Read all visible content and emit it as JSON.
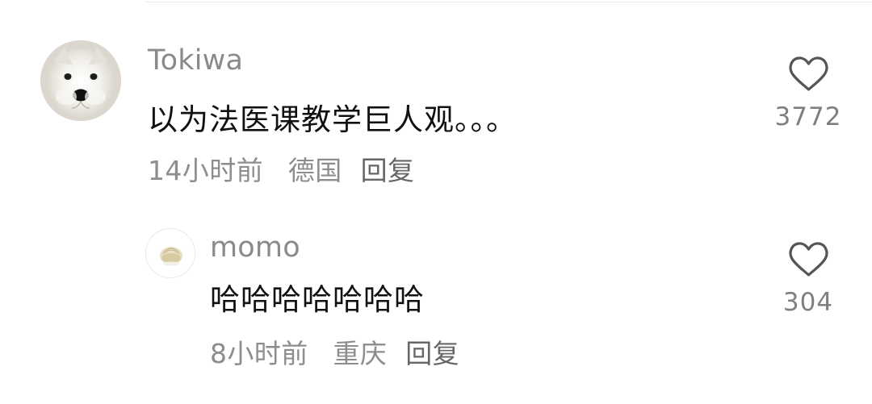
{
  "comments": [
    {
      "username": "Tokiwa",
      "content": "以为法医课教学巨人观。。。",
      "time": "14小时前",
      "location": "德国",
      "reply_label": "回复",
      "likes": "3772",
      "avatar_icon": "samoyed-avatar-icon"
    },
    {
      "username": "momo",
      "content": "哈哈哈哈哈哈哈",
      "time": "8小时前",
      "location": "重庆",
      "reply_label": "回复",
      "likes": "304",
      "avatar_icon": "bun-avatar-icon"
    }
  ]
}
